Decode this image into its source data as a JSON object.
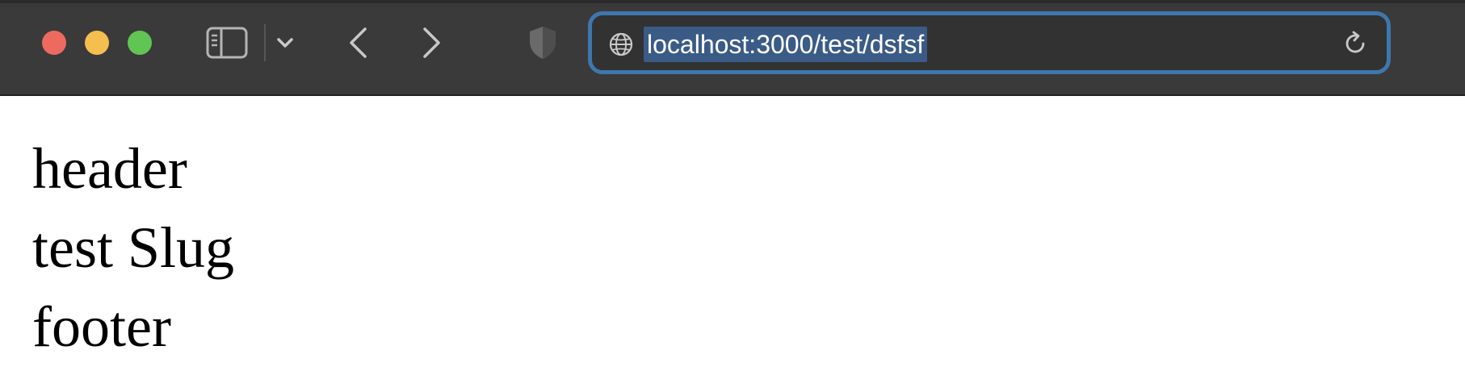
{
  "browser": {
    "address": {
      "url": "localhost:3000/test/dsfsf"
    },
    "icons": {
      "sidebar": "sidebar-icon",
      "chevron": "chevron-down-icon",
      "back": "back-arrow-icon",
      "forward": "forward-arrow-icon",
      "privacy": "shield-icon",
      "site": "globe-icon",
      "reload": "reload-icon"
    },
    "colors": {
      "toolbar": "#3a3a3a",
      "address_focus_ring": "#3e77ad",
      "url_selection": "#3b5b87",
      "close": "#ed6a5e",
      "minimize": "#f4bf4f",
      "maximize": "#61c554"
    }
  },
  "page": {
    "lines": [
      "header",
      "test Slug",
      "footer"
    ]
  }
}
